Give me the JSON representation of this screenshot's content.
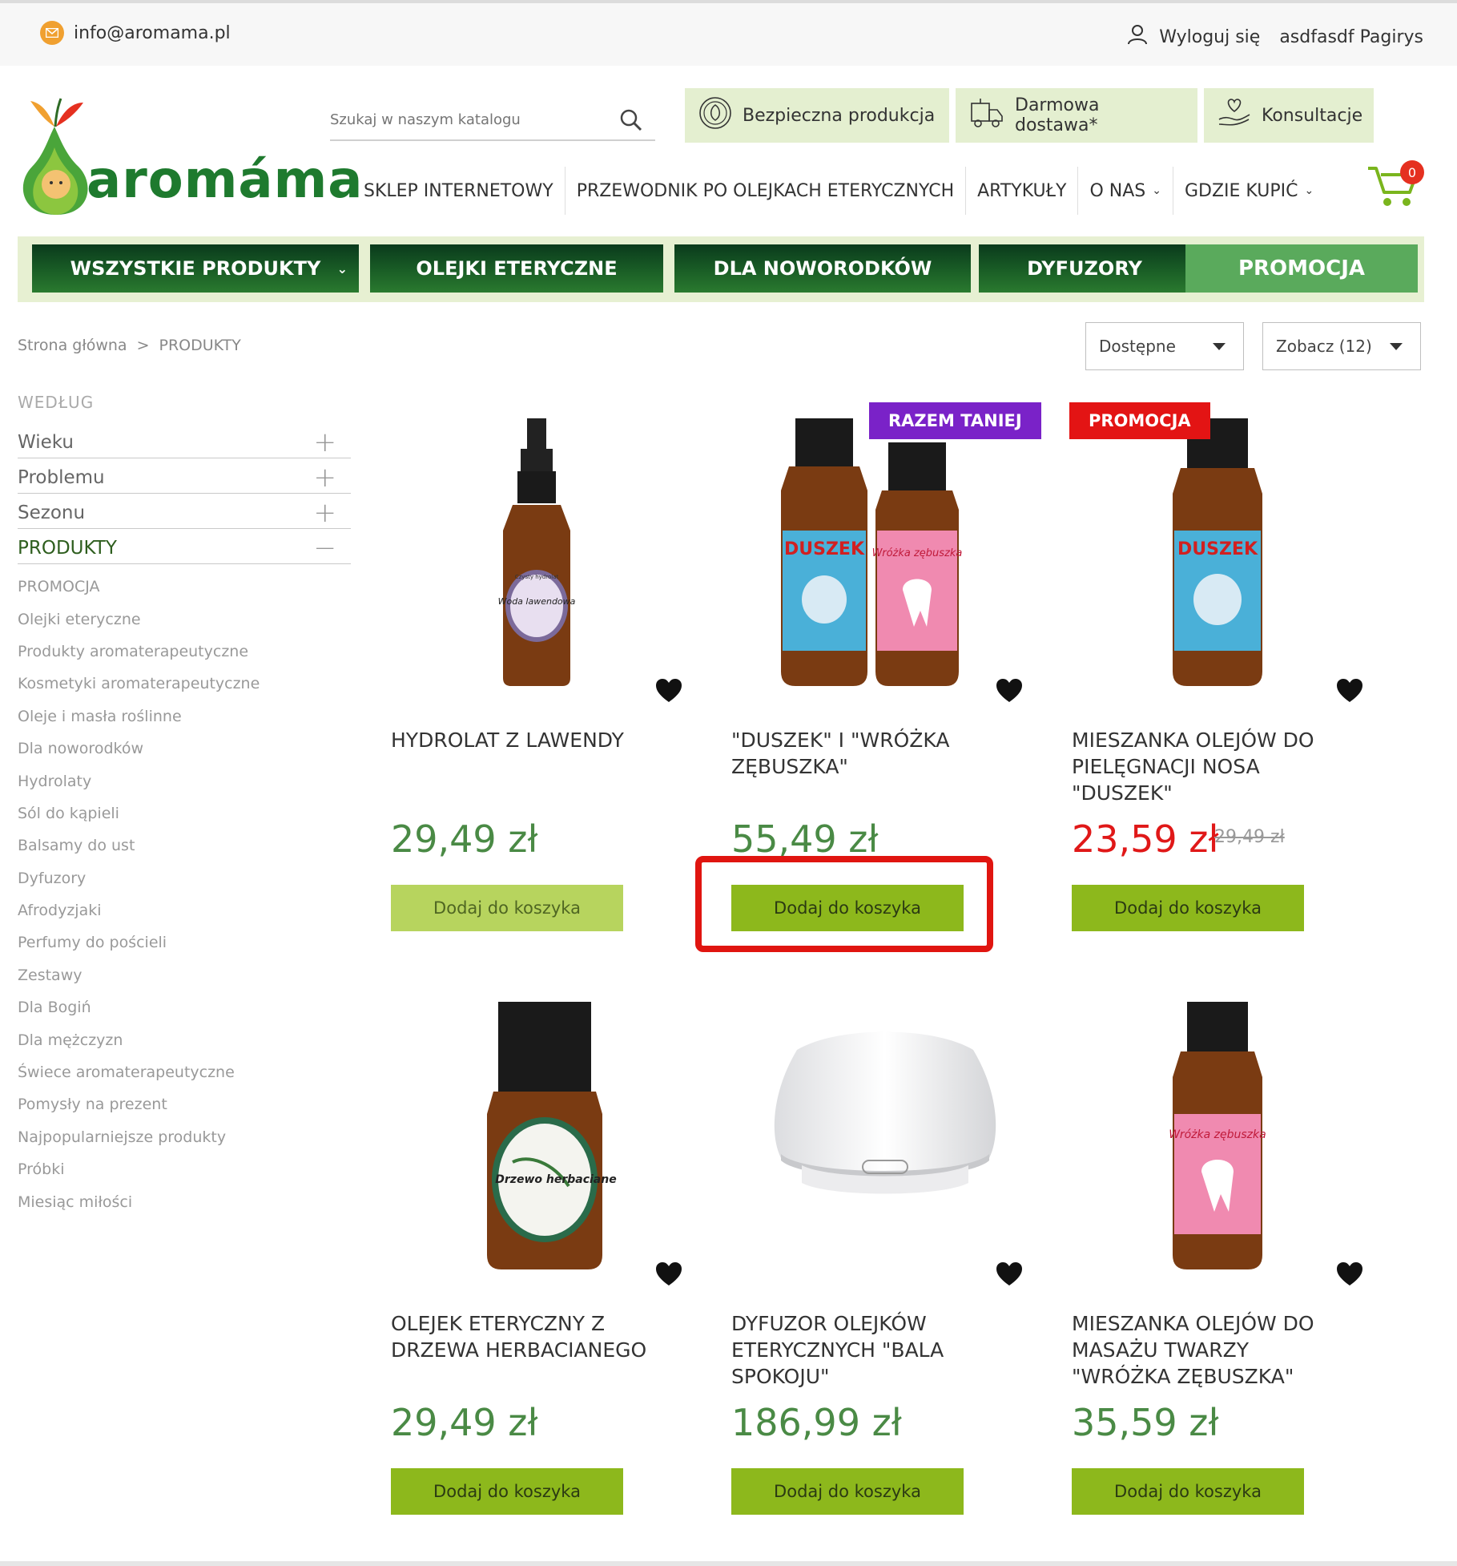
{
  "topbar": {
    "email": "info@aromama.pl",
    "logout_label": "Wyloguj się",
    "user_name": "asdfasdf Pagirys"
  },
  "logo": {
    "text": "aromáma"
  },
  "search": {
    "placeholder": "Szukaj w naszym katalogu"
  },
  "features": [
    {
      "label": "Bezpieczna produkcja",
      "icon": "leaf-badge-icon"
    },
    {
      "label": "Darmowa dostawa*",
      "icon": "delivery-truck-icon"
    },
    {
      "label": "Konsultacje",
      "icon": "hand-heart-icon"
    }
  ],
  "nav": [
    {
      "label": "SKLEP INTERNETOWY",
      "dropdown": false
    },
    {
      "label": "PRZEWODNIK PO OLEJKACH ETERYCZNYCH",
      "dropdown": false
    },
    {
      "label": "ARTYKUŁY",
      "dropdown": false
    },
    {
      "label": "O NAS",
      "dropdown": true
    },
    {
      "label": "GDZIE KUPIĆ",
      "dropdown": true
    }
  ],
  "cart": {
    "count": "0"
  },
  "categories": [
    {
      "label": "WSZYSTKIE PRODUKTY",
      "dropdown": true
    },
    {
      "label": "OLEJKI ETERYCZNE"
    },
    {
      "label": "DLA NOWORODKÓW"
    },
    {
      "label": "DYFUZORY"
    },
    {
      "label": "PROMOCJA"
    }
  ],
  "breadcrumb": {
    "home": "Strona główna",
    "sep": ">",
    "current": "PRODUKTY"
  },
  "sort": {
    "availability": "Dostępne",
    "per_page": "Zobacz (12)"
  },
  "sidebar": {
    "heading": "WEDŁUG",
    "filters": [
      {
        "label": "Wieku",
        "sign": "+"
      },
      {
        "label": "Problemu",
        "sign": "+"
      },
      {
        "label": "Sezonu",
        "sign": "+"
      },
      {
        "label": "PRODUKTY",
        "sign": "−"
      }
    ],
    "links": [
      "PROMOCJA",
      "Olejki eteryczne",
      "Produkty aromaterapeutyczne",
      "Kosmetyki aromaterapeutyczne",
      "Oleje i masła roślinne",
      "Dla noworodków",
      "Hydrolaty",
      "Sól do kąpieli",
      "Balsamy do ust",
      "Dyfuzory",
      "Afrodyzjaki",
      "Perfumy do pościeli",
      "Zestawy",
      "Dla Bogiń",
      "Dla mężczyzn",
      "Świece aromaterapeutyczne",
      "Pomysły na prezent",
      "Najpopularniejsze produkty",
      "Próbki",
      "Miesiąc miłości"
    ]
  },
  "products": [
    {
      "name": "HYDROLAT Z LAWENDY",
      "price": "29,49 zł",
      "button": "Dodaj do koszyka",
      "image": "lavender-hydrolat-bottle",
      "bottle_label": "Woda lawendowa",
      "bottle_sublabel": "Czysty hydrolat"
    },
    {
      "name": "\"DUSZEK\" I \"WRÓŻKA ZĘBUSZKA\"",
      "price": "55,49 zł",
      "button": "Dodaj do koszyka",
      "badge": "RAZEM TANIEJ",
      "image": "duszek-and-wrozka-bottles",
      "bottle_label": "DUSZEK",
      "bottle_label_2": "Wróżka zębuszka"
    },
    {
      "name": "MIESZANKA OLEJÓW DO PIELĘGNACJI NOSA \"DUSZEK\"",
      "price": "23,59 zł",
      "old_price": "29,49 zł",
      "button": "Dodaj do koszyka",
      "badge": "PROMOCJA",
      "image": "duszek-bottle",
      "bottle_label": "DUSZEK"
    },
    {
      "name": "OLEJEK ETERYCZNY Z DRZEWA HERBACIANEGO",
      "price": "29,49 zł",
      "button": "Dodaj do koszyka",
      "image": "tea-tree-oil-bottle",
      "bottle_label": "Drzewo herbaciane"
    },
    {
      "name": "DYFUZOR OLEJKÓW ETERYCZNYCH \"BALA SPOKOJU\"",
      "price": "186,99 zł",
      "button": "Dodaj do koszyka",
      "image": "white-diffuser"
    },
    {
      "name": "MIESZANKA OLEJÓW DO MASAŻU TWARZY \"WRÓŻKA ZĘBUSZKA\"",
      "price": "35,59 zł",
      "button": "Dodaj do koszyka",
      "image": "wrozka-zebuszka-bottle",
      "bottle_label": "Wróżka zębuszka"
    }
  ],
  "colors": {
    "brand_green": "#1e7a2e",
    "button_green": "#8db81c",
    "price_green": "#4a8a45",
    "promo_red": "#e31414",
    "badge_purple": "#7a22c8",
    "highlight_red": "#e01510"
  }
}
